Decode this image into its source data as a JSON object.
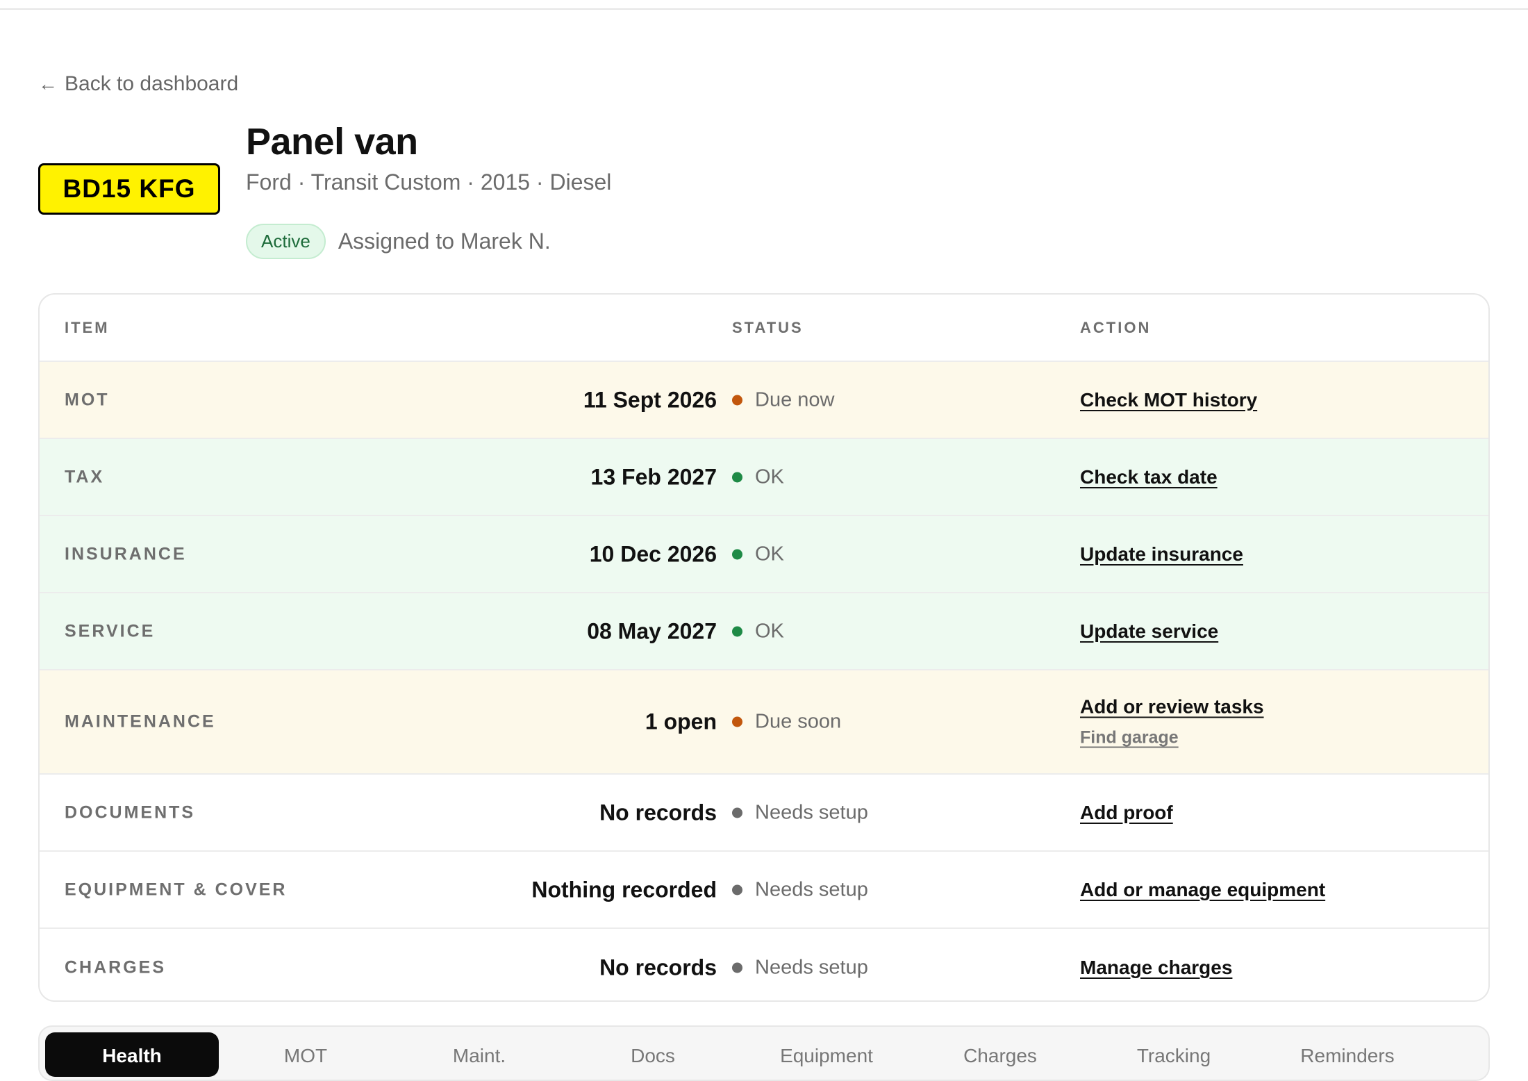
{
  "nav": {
    "back_label": "Back to dashboard",
    "back_icon": "arrow-left-icon"
  },
  "vehicle": {
    "plate": "BD15 KFG",
    "title": "Panel van",
    "subtitle": "Ford · Transit Custom · 2015 · Diesel",
    "status_badge": "Active",
    "assigned": "Assigned to Marek N."
  },
  "colors": {
    "plate_bg": "#fff200",
    "warn_row": "#fdf9ea",
    "ok_row": "#eefaf1",
    "dot_warn": "#c2570c",
    "dot_ok": "#1e8a46",
    "dot_neutral": "#6b6b6b",
    "badge_bg": "#e4f8ea",
    "tab_active": "#0b0b0b"
  },
  "table": {
    "headers": {
      "item": "ITEM",
      "status": "STATUS",
      "action": "ACTION"
    },
    "rows": [
      {
        "item": "MOT",
        "value": "11 Sept 2026",
        "status": "Due now",
        "tone": "warn",
        "action": "Check MOT history"
      },
      {
        "item": "TAX",
        "value": "13 Feb 2027",
        "status": "OK",
        "tone": "ok",
        "action": "Check tax date"
      },
      {
        "item": "INSURANCE",
        "value": "10 Dec 2026",
        "status": "OK",
        "tone": "ok",
        "action": "Update insurance"
      },
      {
        "item": "SERVICE",
        "value": "08 May 2027",
        "status": "OK",
        "tone": "ok",
        "action": "Update service"
      },
      {
        "item": "MAINTENANCE",
        "value": "1 open",
        "status": "Due soon",
        "tone": "warn",
        "action": "Add or review tasks",
        "secondary_action": "Find garage"
      },
      {
        "item": "DOCUMENTS",
        "value": "No records",
        "status": "Needs setup",
        "tone": "neutral",
        "action": "Add proof"
      },
      {
        "item": "EQUIPMENT & COVER",
        "value": "Nothing recorded",
        "status": "Needs setup",
        "tone": "neutral",
        "action": "Add or manage equipment"
      },
      {
        "item": "CHARGES",
        "value": "No records",
        "status": "Needs setup",
        "tone": "neutral",
        "action": "Manage charges"
      }
    ]
  },
  "tabs": [
    {
      "label": "Health",
      "active": true
    },
    {
      "label": "MOT",
      "active": false
    },
    {
      "label": "Maint.",
      "active": false
    },
    {
      "label": "Docs",
      "active": false
    },
    {
      "label": "Equipment",
      "active": false
    },
    {
      "label": "Charges",
      "active": false
    },
    {
      "label": "Tracking",
      "active": false
    },
    {
      "label": "Reminders",
      "active": false
    }
  ]
}
